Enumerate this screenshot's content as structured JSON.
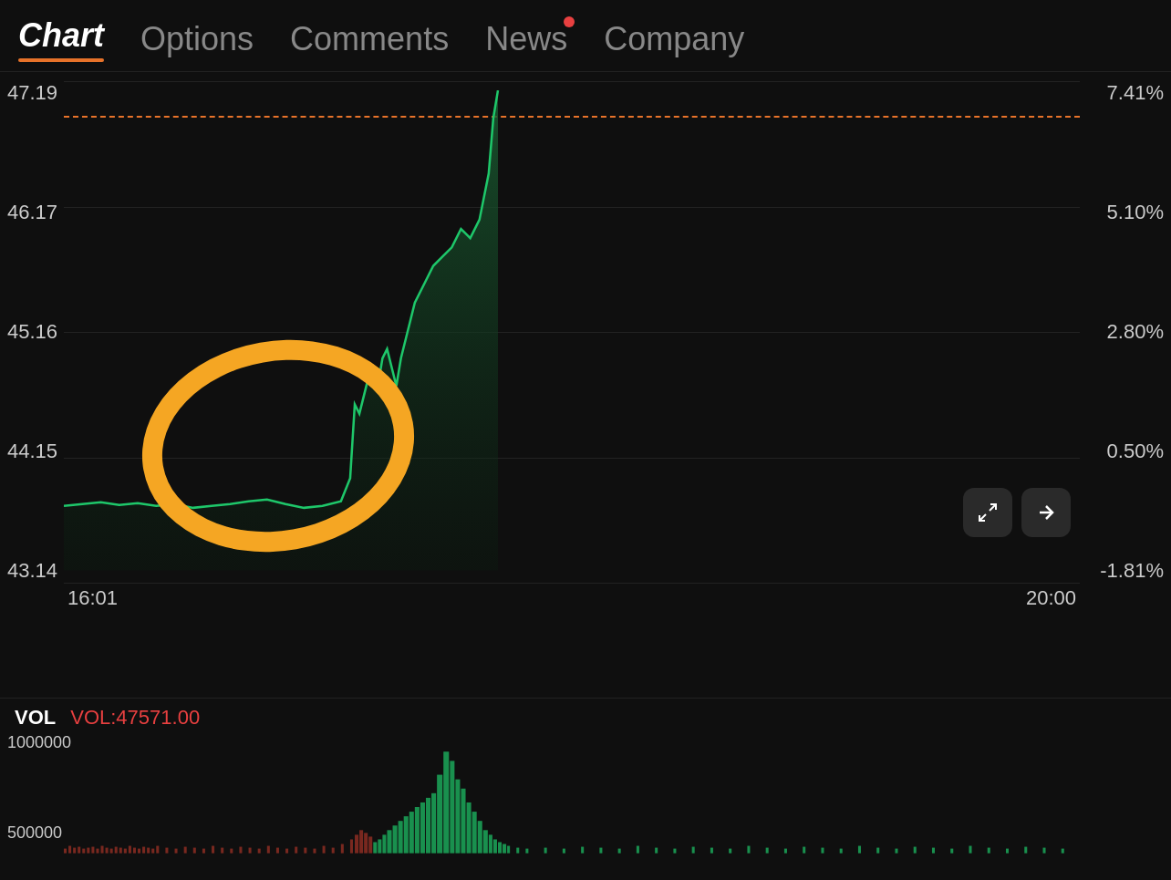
{
  "nav": {
    "items": [
      {
        "id": "chart",
        "label": "Chart",
        "active": true,
        "notification": false
      },
      {
        "id": "options",
        "label": "Options",
        "active": false,
        "notification": false
      },
      {
        "id": "comments",
        "label": "Comments",
        "active": false,
        "notification": false
      },
      {
        "id": "news",
        "label": "News",
        "active": false,
        "notification": true
      },
      {
        "id": "company",
        "label": "Company",
        "active": false,
        "notification": false
      }
    ]
  },
  "chart": {
    "y_labels_left": [
      "47.19",
      "46.17",
      "45.16",
      "44.15",
      "43.14"
    ],
    "y_labels_right": [
      "7.41%",
      "5.10%",
      "2.80%",
      "0.50%",
      "-1.81%"
    ],
    "x_labels": [
      "16:01",
      "20:00"
    ],
    "ref_line_value": "47.19"
  },
  "volume": {
    "label": "VOL",
    "value": "VOL:47571.00",
    "y_labels": [
      "1000000",
      "500000"
    ]
  },
  "controls": {
    "expand_icon": "⌐",
    "collapse_icon": "←|"
  }
}
